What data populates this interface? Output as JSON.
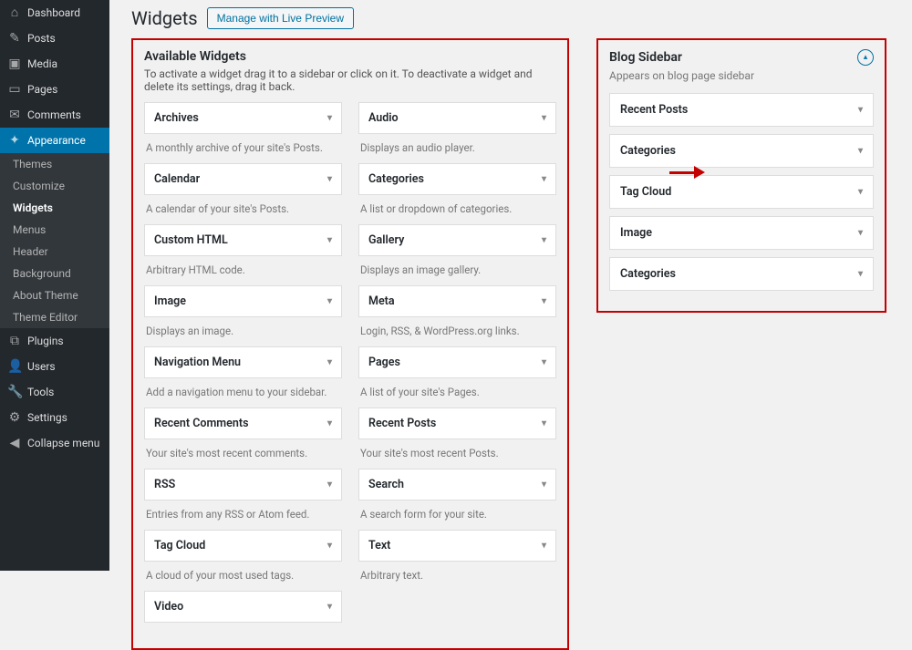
{
  "sidebar": {
    "items": [
      {
        "icon": "⌂",
        "label": "Dashboard"
      },
      {
        "icon": "✎",
        "label": "Posts"
      },
      {
        "icon": "▣",
        "label": "Media"
      },
      {
        "icon": "▭",
        "label": "Pages"
      },
      {
        "icon": "✉",
        "label": "Comments"
      },
      {
        "icon": "✦",
        "label": "Appearance",
        "active": true
      },
      {
        "icon": "⧉",
        "label": "Plugins"
      },
      {
        "icon": "👤",
        "label": "Users"
      },
      {
        "icon": "🔧",
        "label": "Tools"
      },
      {
        "icon": "⚙",
        "label": "Settings"
      },
      {
        "icon": "◀",
        "label": "Collapse menu"
      }
    ],
    "subitems": [
      "Themes",
      "Customize",
      "Widgets",
      "Menus",
      "Header",
      "Background",
      "About Theme",
      "Theme Editor"
    ],
    "currentSub": "Widgets"
  },
  "page": {
    "title": "Widgets",
    "previewBtn": "Manage with Live Preview"
  },
  "available": {
    "title": "Available Widgets",
    "desc": "To activate a widget drag it to a sidebar or click on it. To deactivate a widget and delete its settings, drag it back.",
    "widgets": [
      {
        "name": "Archives",
        "desc": "A monthly archive of your site's Posts."
      },
      {
        "name": "Audio",
        "desc": "Displays an audio player."
      },
      {
        "name": "Calendar",
        "desc": "A calendar of your site's Posts."
      },
      {
        "name": "Categories",
        "desc": "A list or dropdown of categories."
      },
      {
        "name": "Custom HTML",
        "desc": "Arbitrary HTML code."
      },
      {
        "name": "Gallery",
        "desc": "Displays an image gallery."
      },
      {
        "name": "Image",
        "desc": "Displays an image."
      },
      {
        "name": "Meta",
        "desc": "Login, RSS, & WordPress.org links."
      },
      {
        "name": "Navigation Menu",
        "desc": "Add a navigation menu to your sidebar."
      },
      {
        "name": "Pages",
        "desc": "A list of your site's Pages."
      },
      {
        "name": "Recent Comments",
        "desc": "Your site's most recent comments."
      },
      {
        "name": "Recent Posts",
        "desc": "Your site's most recent Posts."
      },
      {
        "name": "RSS",
        "desc": "Entries from any RSS or Atom feed."
      },
      {
        "name": "Search",
        "desc": "A search form for your site."
      },
      {
        "name": "Tag Cloud",
        "desc": "A cloud of your most used tags."
      },
      {
        "name": "Text",
        "desc": "Arbitrary text."
      },
      {
        "name": "Video",
        "desc": ""
      }
    ]
  },
  "blogSidebar": {
    "title": "Blog Sidebar",
    "desc": "Appears on blog page sidebar",
    "widgets": [
      "Recent Posts",
      "Categories",
      "Tag Cloud",
      "Image",
      "Categories"
    ]
  }
}
